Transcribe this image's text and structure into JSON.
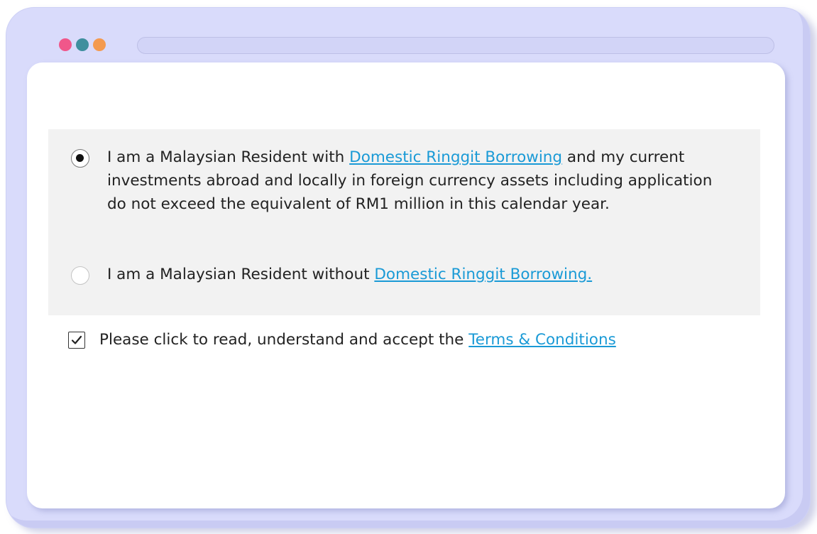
{
  "window": {
    "dots": [
      {
        "name": "red-dot",
        "color": "#f0578a"
      },
      {
        "name": "teal-dot",
        "color": "#3f8f9e"
      },
      {
        "name": "orange-dot",
        "color": "#f49a4f"
      }
    ]
  },
  "form": {
    "options": [
      {
        "selected": true,
        "text_before": "I am a Malaysian Resident with ",
        "link": "Domestic Ringgit Borrowing",
        "text_after": " and my current investments abroad and locally in foreign currency assets including application do not exceed the equivalent of RM1 million in this calendar year."
      },
      {
        "selected": false,
        "text_before": "I am a Malaysian Resident without ",
        "link": "Domestic Ringgit Borrowing.",
        "text_after": ""
      }
    ],
    "terms": {
      "checked": true,
      "text": "Please click to read, understand and accept the ",
      "link": "Terms & Conditions"
    }
  },
  "colors": {
    "link": "#1a9ad6",
    "frame": "#d9dbfb",
    "options_bg": "#f2f2f2"
  }
}
